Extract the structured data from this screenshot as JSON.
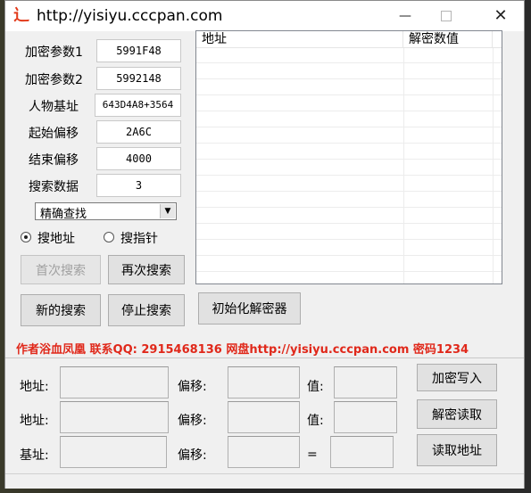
{
  "window": {
    "title": "http://yisiyu.cccpan.com",
    "icon_glyph": "⻌",
    "min_glyph": "—",
    "close_glyph": "✕"
  },
  "fields": [
    {
      "label": "加密参数1",
      "value": "5991F48"
    },
    {
      "label": "加密参数2",
      "value": "5992148"
    },
    {
      "label": "人物基址",
      "value": "643D4A8+3564"
    },
    {
      "label": "起始偏移",
      "value": "2A6C"
    },
    {
      "label": "结束偏移",
      "value": "4000"
    },
    {
      "label": "搜索数据",
      "value": "3"
    }
  ],
  "search_mode": {
    "selected": "精确查找"
  },
  "radios": [
    {
      "label": "搜地址",
      "checked": true
    },
    {
      "label": "搜指针",
      "checked": false
    }
  ],
  "buttons": {
    "first_search": "首次搜索",
    "search_again": "再次搜索",
    "new_search": "新的搜索",
    "stop_search": "停止搜索",
    "init_decryptor": "初始化解密器",
    "encrypt_write": "加密写入",
    "decrypt_read": "解密读取",
    "read_address": "读取地址"
  },
  "results_list": {
    "columns": [
      "地址",
      "解密数值"
    ],
    "rows": []
  },
  "credit": "作者浴血凤凰  联系QQ: 2915468136  网盘http://yisiyu.cccpan.com 密码1234",
  "bottom_form": {
    "address_label": "地址:",
    "offset_label": "偏移:",
    "value_label": "值:",
    "base_label": "基址:",
    "equals_label": "="
  },
  "colors": {
    "credit": "#e0281a",
    "icon": "#e23a1a"
  }
}
